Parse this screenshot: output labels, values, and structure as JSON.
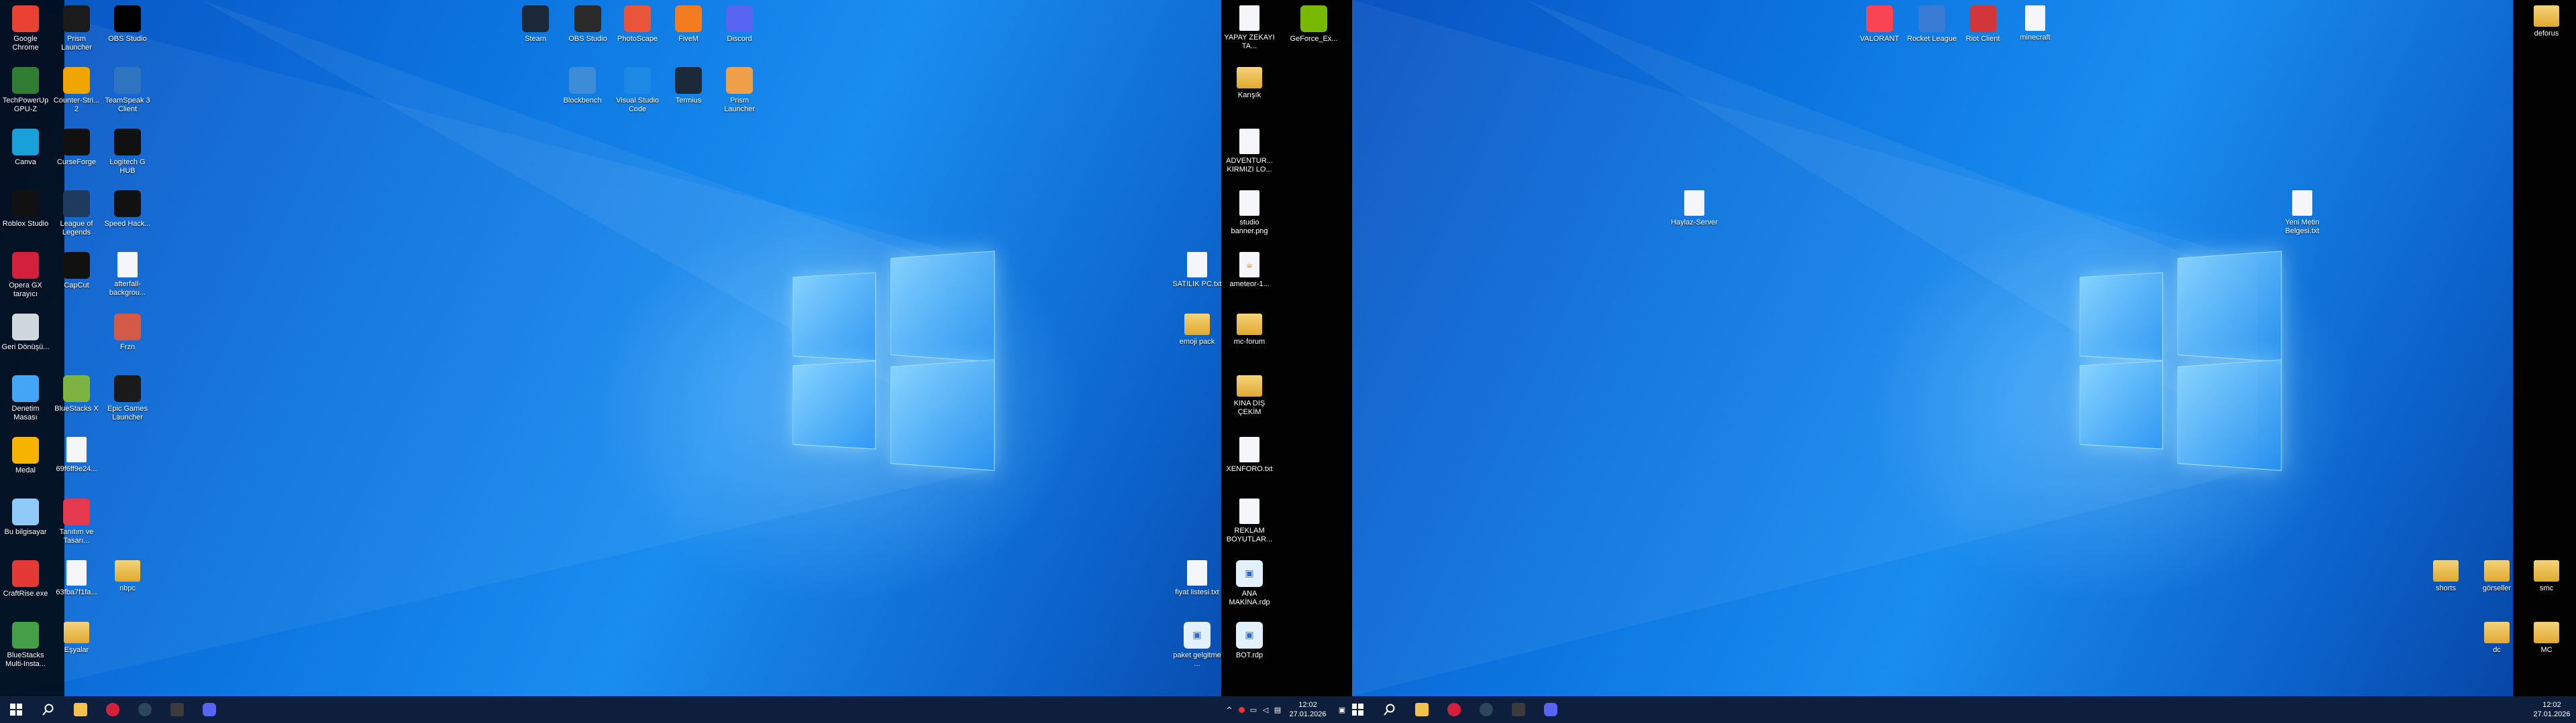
{
  "left_monitor": {
    "icons_col1": [
      {
        "label": "Google Chrome",
        "glyph": "chrome-icon",
        "color": "#e94235"
      },
      {
        "label": "TechPowerUp GPU-Z",
        "glyph": "gpuz-icon",
        "color": "#2e7d32"
      },
      {
        "label": "Canva",
        "glyph": "canva-icon",
        "color": "#1aa0d8"
      },
      {
        "label": "Roblox Studio",
        "glyph": "roblox-studio-icon",
        "color": "#111111"
      },
      {
        "label": "Opera GX tarayıcı",
        "glyph": "opera-gx-icon",
        "color": "#d3213d"
      },
      {
        "label": "Geri Dönüşü...",
        "glyph": "recycle-bin-icon",
        "color": "#cfd8dc"
      },
      {
        "label": "Denetim Masası",
        "glyph": "control-panel-icon",
        "color": "#42a5f5"
      },
      {
        "label": "Medal",
        "glyph": "medal-icon",
        "color": "#f6b400"
      },
      {
        "label": "Bu bilgisayar",
        "glyph": "this-pc-icon",
        "color": "#90caf9"
      },
      {
        "label": "CraftRise.exe",
        "glyph": "craftrise-icon",
        "color": "#e53935"
      },
      {
        "label": "BlueStacks Multi-Insta...",
        "glyph": "bluestacks-multi-icon",
        "color": "#43a047"
      }
    ],
    "icons_col2": [
      {
        "label": "Prism Launcher",
        "glyph": "prism-launcher-icon",
        "color": "#1b1b1b"
      },
      {
        "label": "Counter-Stri... 2",
        "glyph": "counter-strike-icon",
        "color": "#f0a500"
      },
      {
        "label": "CurseForge",
        "glyph": "curseforge-icon",
        "color": "#111111"
      },
      {
        "label": "League of Legends",
        "glyph": "league-icon",
        "color": "#1e3a5f"
      },
      {
        "label": "CapCut",
        "glyph": "capcut-icon",
        "color": "#111111"
      },
      {
        "label": "BlueStacks X",
        "glyph": "bluestacks-x-icon",
        "color": "#7cb342"
      },
      {
        "label": "69f6ff9e24...",
        "glyph": "image-file-icon",
        "color": "#222222"
      },
      {
        "label": "Tanıtım ve Tasarı...",
        "glyph": "tanitim-icon",
        "color": "#e53950"
      },
      {
        "label": "63fba7f1fa...",
        "glyph": "image-file-icon",
        "color": "#1a1a1a"
      },
      {
        "label": "Eşyalar",
        "glyph": "folder-icon",
        "color": "#e0a92e"
      }
    ],
    "icons_col3": [
      {
        "label": "OBS Studio",
        "glyph": "obs-icon",
        "color": "#000000"
      },
      {
        "label": "TeamSpeak 3 Client",
        "glyph": "teamspeak-icon",
        "color": "#2f74c0"
      },
      {
        "label": "Logitech G HUB",
        "glyph": "logitech-icon",
        "color": "#111111"
      },
      {
        "label": "Speed Hack...",
        "glyph": "g-icon",
        "color": "#111111"
      },
      {
        "label": "afterfall-backgrou...",
        "glyph": "file-icon",
        "color": "#b0b7c3"
      },
      {
        "label": "Frzn",
        "glyph": "frzn-icon",
        "color": "#d45a48"
      },
      {
        "label": "Epic Games Launcher",
        "glyph": "epic-icon",
        "color": "#1a1a1a"
      },
      {
        "label": "nbpc",
        "glyph": "folder-icon",
        "color": "#e0a92e"
      }
    ],
    "icons_top": [
      {
        "label": "Steam",
        "glyph": "steam-icon",
        "color": "#1b2838"
      },
      {
        "label": "OBS Studio",
        "glyph": "obs-icon",
        "color": "#2b2b2b"
      },
      {
        "label": "PhotoScape",
        "glyph": "photoscape-icon",
        "color": "#e8553b"
      },
      {
        "label": "FiveM",
        "glyph": "fivem-icon",
        "color": "#f47c20"
      },
      {
        "label": "Discord",
        "glyph": "discord-icon",
        "color": "#5865f2"
      }
    ],
    "icons_top2": [
      {
        "label": "Blockbench",
        "glyph": "blockbench-icon",
        "color": "#3d8cd8"
      },
      {
        "label": "Visual Studio Code",
        "glyph": "vscode-icon",
        "color": "#1e88e5"
      },
      {
        "label": "Termius",
        "glyph": "termius-icon",
        "color": "#1a2a3a"
      },
      {
        "label": "Prism Launcher",
        "glyph": "prism-launcher-icon",
        "color": "#f0a04b"
      }
    ],
    "icons_right": [
      {
        "label": "SATILIK PC.txt",
        "glyph": "text-file-icon"
      },
      {
        "label": "emoji pack",
        "glyph": "folder-icon"
      },
      {
        "label": "fiyat listesi.txt",
        "glyph": "text-file-icon"
      },
      {
        "label": "paket gelgitme ...",
        "glyph": "rdp-icon"
      }
    ],
    "icons_black": [
      {
        "label": "YAPAY ZEKAYI TA...",
        "glyph": "image-file-icon"
      },
      {
        "label": "Karışık",
        "glyph": "folder-icon"
      },
      {
        "label": "ADVENTUR... KIRMIZI LO...",
        "glyph": "image-file-icon"
      },
      {
        "label": "studio banner.png",
        "glyph": "image-file-icon"
      },
      {
        "label": "ameteor-1...",
        "glyph": "java-file-icon"
      },
      {
        "label": "mc-forum",
        "glyph": "folder-icon"
      },
      {
        "label": "KINA DIŞ ÇEKİM",
        "glyph": "folder-icon"
      },
      {
        "label": "XENFORO.txt",
        "glyph": "text-file-icon"
      },
      {
        "label": "REKLAM BOYUTLAR...",
        "glyph": "text-file-icon"
      },
      {
        "label": "ANA MAKİNA.rdp",
        "glyph": "rdp-icon"
      },
      {
        "label": "BOT.rdp",
        "glyph": "rdp-icon"
      }
    ],
    "icons_black2": [
      {
        "label": "GeForce_Ex...",
        "glyph": "geforce-icon",
        "color": "#76b900"
      }
    ],
    "taskbar": {
      "time": "12:02",
      "date": "27.01.2026",
      "apps": [
        "start-icon",
        "search-icon",
        "file-explorer-icon",
        "opera-gx-icon",
        "steam-icon",
        "taskbar-app-icon",
        "discord-icon"
      ]
    }
  },
  "right_monitor": {
    "icons_top": [
      {
        "label": "VALORANT",
        "glyph": "valorant-icon",
        "color": "#fa4454"
      },
      {
        "label": "Rocket League",
        "glyph": "rocket-league-icon",
        "color": "#3a7bd5"
      },
      {
        "label": "Riot Client",
        "glyph": "riot-client-icon",
        "color": "#d13639"
      },
      {
        "label": "minecraft",
        "glyph": "text-file-icon"
      }
    ],
    "icons_mid": [
      {
        "label": "Haylaz-Server",
        "glyph": "text-file-icon"
      },
      {
        "label": "Yeni Metin Belgesi.txt",
        "glyph": "text-file-icon"
      }
    ],
    "icons_corner": [
      {
        "label": "deforus",
        "glyph": "folder-icon"
      }
    ],
    "icons_bottom": [
      {
        "label": "shorts",
        "glyph": "folder-icon"
      },
      {
        "label": "görseller",
        "glyph": "folder-icon"
      },
      {
        "label": "smc",
        "glyph": "folder-icon"
      },
      {
        "label": "dc",
        "glyph": "folder-icon"
      },
      {
        "label": "MC",
        "glyph": "folder-icon"
      }
    ],
    "taskbar": {
      "time": "12:02",
      "date": "27.01.2026"
    }
  }
}
